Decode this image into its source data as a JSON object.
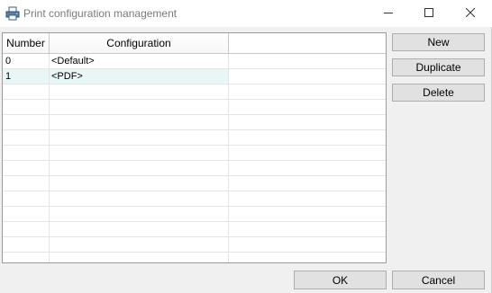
{
  "window": {
    "title": "Print configuration management",
    "icon": "printer-icon",
    "controls": [
      "minimize-icon",
      "maximize-icon",
      "close-icon"
    ]
  },
  "grid": {
    "columns": [
      "Number",
      "Configuration"
    ],
    "rows": [
      {
        "number": "0",
        "configuration": "<Default>"
      },
      {
        "number": "1",
        "configuration": "<PDF>"
      }
    ],
    "alt_row_color": "#e9f6f7"
  },
  "side_buttons": {
    "new": "New",
    "duplicate": "Duplicate",
    "delete": "Delete"
  },
  "footer_buttons": {
    "ok": "OK",
    "cancel": "Cancel"
  }
}
